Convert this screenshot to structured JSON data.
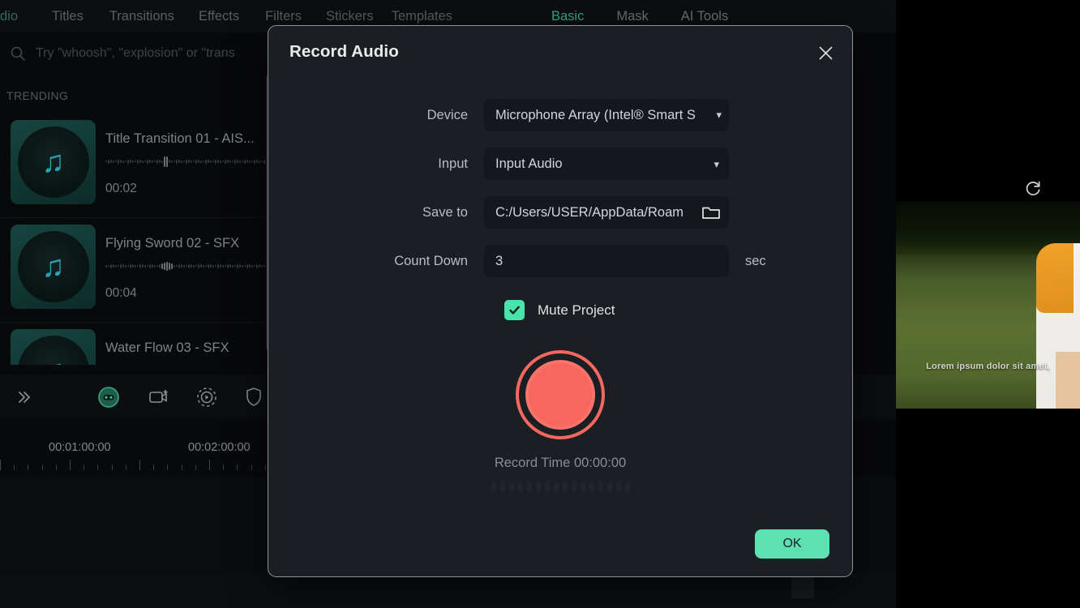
{
  "background": {
    "nav_tabs": [
      {
        "label": "dio",
        "active": true
      },
      {
        "label": "Titles",
        "active": false
      },
      {
        "label": "Transitions",
        "active": false
      },
      {
        "label": "Effects",
        "active": false
      },
      {
        "label": "Filters",
        "active": false
      },
      {
        "label": "Stickers",
        "active": false
      },
      {
        "label": "Templates",
        "active": false
      }
    ],
    "search_placeholder": "Try \"whoosh\", \"explosion\" or \"trans",
    "section_header": "TRENDING",
    "audio_items": [
      {
        "title": "Title Transition 01 - AIS...",
        "duration": "00:02"
      },
      {
        "title": "Flying Sword 02 - SFX",
        "duration": "00:04"
      },
      {
        "title": "Water Flow 03 - SFX",
        "duration": ""
      }
    ],
    "property_tabs": [
      {
        "label": "Basic",
        "active": true
      },
      {
        "label": "Mask",
        "active": false
      },
      {
        "label": "AI Tools",
        "active": false
      }
    ],
    "timeline": {
      "ruler_labels": [
        "00:01:00:00",
        "00:02:00:00"
      ],
      "toolbar_icons": [
        "double-chevron-right-icon",
        "record-audio-icon",
        "video-snapshot-icon",
        "play-circle-icon",
        "shield-icon"
      ]
    },
    "preview_caption": "Lorem ipsum dolor sit amet,"
  },
  "dialog": {
    "title": "Record Audio",
    "close_label": "✕",
    "fields": {
      "device": {
        "label": "Device",
        "value": "Microphone Array (Intel® Smart S"
      },
      "input": {
        "label": "Input",
        "value": "Input Audio"
      },
      "save_to": {
        "label": "Save to",
        "value": "C:/Users/USER/AppData/Roam"
      },
      "count_down": {
        "label": "Count Down",
        "value": "3",
        "suffix": "sec"
      }
    },
    "mute_project": {
      "label": "Mute Project",
      "checked": true
    },
    "record_time_label": "Record Time 00:00:00",
    "ok_label": "OK",
    "colors": {
      "accent_green": "#5fe0b2",
      "record_red": "#f7675e",
      "dialog_bg": "#1b1e23",
      "field_bg": "#14171b"
    }
  }
}
